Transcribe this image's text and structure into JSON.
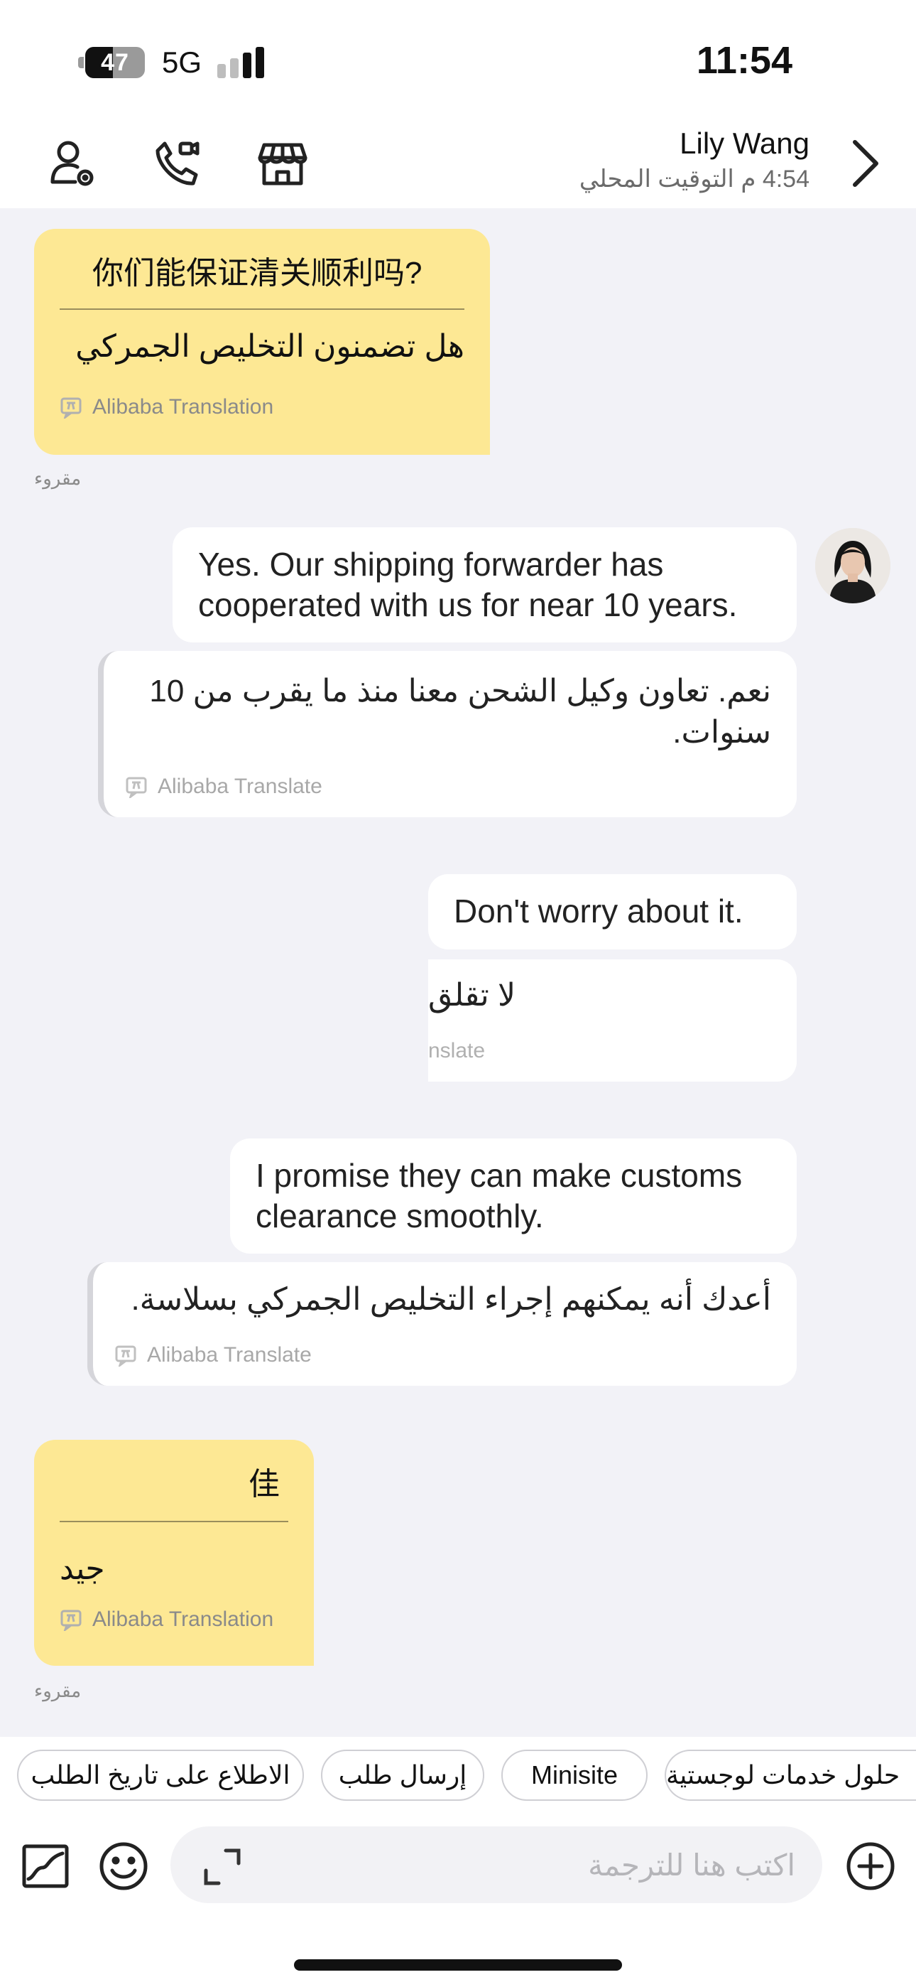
{
  "status_bar": {
    "battery_percent": "47",
    "battery_level": 0.47,
    "network": "5G",
    "time": "11:54"
  },
  "header": {
    "contact_name": "Lily Wang",
    "local_time": "4:54 م التوقيت المحلي",
    "icons": [
      "contact-profile-icon",
      "video-call-icon",
      "store-icon"
    ],
    "forward_icon": "chevron-right-icon"
  },
  "messages": [
    {
      "direction": "incoming",
      "original": "你们能保证清关顺利吗?",
      "translation": "هل تضمنون التخليص الجمركي",
      "credit": "Alibaba Translation",
      "status": "مقروء"
    },
    {
      "direction": "outgoing",
      "text": "Yes. Our shipping forwarder has cooperated with us for near 10 years.",
      "translation": "نعم. تعاون وكيل الشحن معنا منذ ما يقرب من 10 سنوات.",
      "credit": "Alibaba Translate"
    },
    {
      "direction": "outgoing",
      "text": "Don't worry about it.",
      "translation": "لا تقلق",
      "credit": "nslate"
    },
    {
      "direction": "outgoing",
      "text": "I promise they can make customs clearance smoothly.",
      "translation": "أعدك أنه يمكنهم إجراء التخليص الجمركي بسلاسة.",
      "credit": "Alibaba Translate"
    },
    {
      "direction": "incoming",
      "original": "佳",
      "translation": "جيد",
      "credit": "Alibaba Translation",
      "status": "مقروء"
    }
  ],
  "quick_replies": [
    "الاطلاع على تاريخ الطلب",
    "إرسال طلب",
    "Minisite",
    "حلول خدمات لوجستية"
  ],
  "input": {
    "placeholder": "اكتب هنا للترجمة",
    "icons": [
      "image-icon",
      "emoji-icon",
      "expand-icon",
      "add-icon"
    ]
  },
  "colors": {
    "incoming_bubble": "#fde894",
    "outgoing_bubble": "#ffffff",
    "chat_background": "#f2f2f7",
    "secondary_text": "#8a8a8a"
  }
}
